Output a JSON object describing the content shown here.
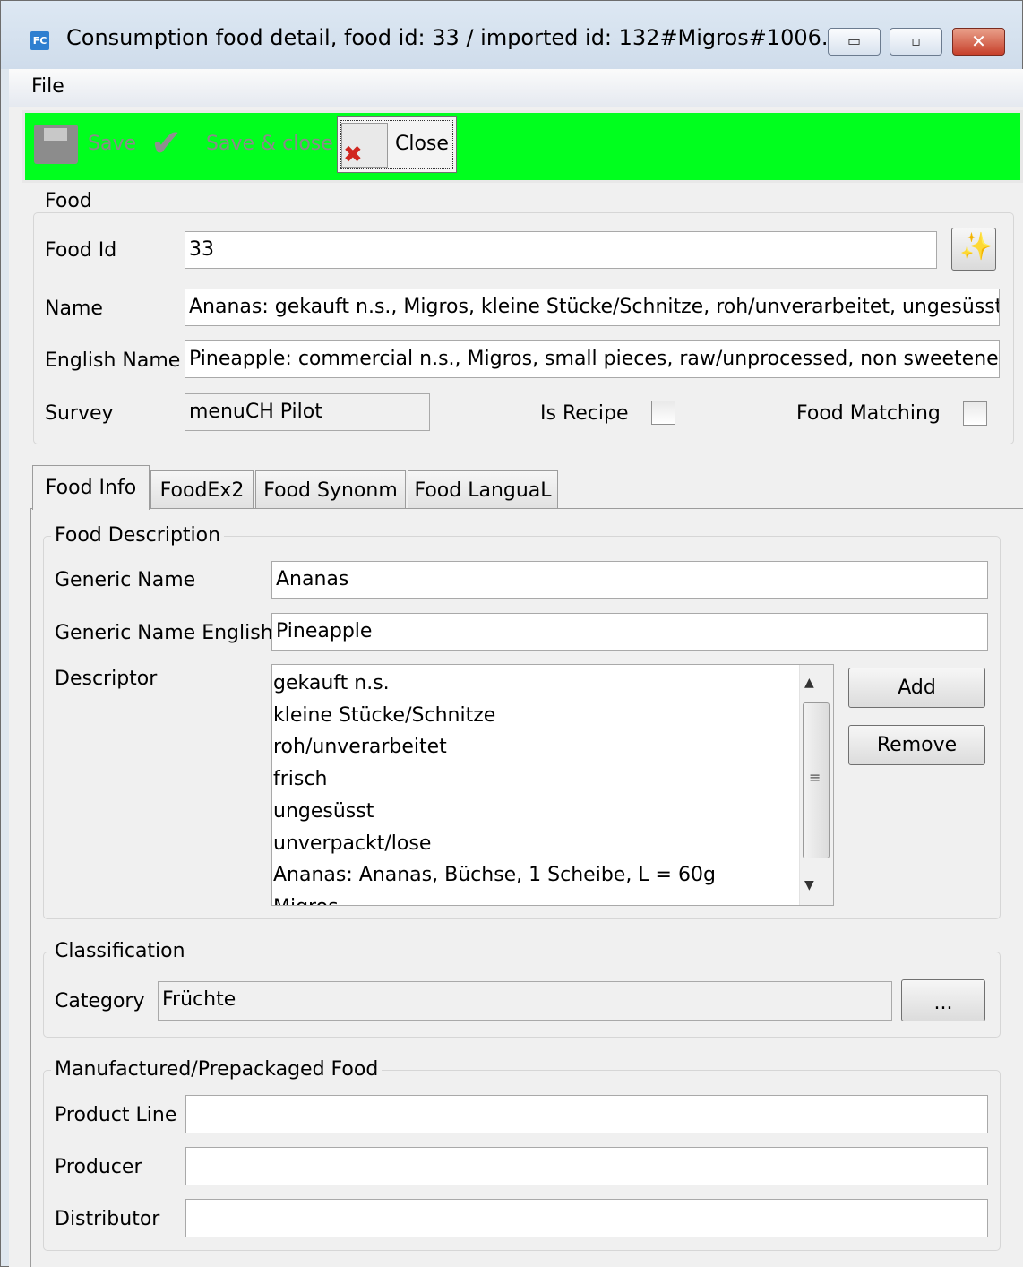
{
  "window": {
    "title": "Consumption food detail, food id: 33 / imported id: 132#Migros#1006...",
    "app_icon": "FC",
    "minimize": "▭",
    "maximize": "▫",
    "close": "✕"
  },
  "menu": {
    "file": "File"
  },
  "toolbar": {
    "save_label": "Save",
    "save_close_label": "Save & close",
    "close_label": "Close",
    "background": "#00ff1e"
  },
  "food": {
    "group_title": "Food",
    "food_id_label": "Food Id",
    "food_id": "33",
    "name_label": "Name",
    "name": "Ananas: gekauft n.s., Migros, kleine Stücke/Schnitze, roh/unverarbeitet, ungesüsst",
    "english_name_label": "English Name",
    "english_name": "Pineapple: commercial n.s., Migros, small pieces, raw/unprocessed, non sweetened",
    "survey_label": "Survey",
    "survey": "menuCH Pilot",
    "is_recipe_label": "Is Recipe",
    "is_recipe": false,
    "food_matching_label": "Food Matching",
    "food_matching": false
  },
  "tabs": [
    {
      "label": "Food Info",
      "active": true
    },
    {
      "label": "FoodEx2",
      "active": false
    },
    {
      "label": "Food Synonm",
      "active": false
    },
    {
      "label": "Food LanguaL",
      "active": false
    }
  ],
  "food_description": {
    "group_title": "Food Description",
    "generic_name_label": "Generic Name",
    "generic_name": "Ananas",
    "generic_name_english_label": "Generic Name English",
    "generic_name_english": "Pineapple",
    "descriptor_label": "Descriptor",
    "descriptors": [
      "gekauft n.s.",
      "kleine Stücke/Schnitze",
      "roh/unverarbeitet",
      "frisch",
      "ungesüsst",
      "unverpackt/lose",
      "Ananas: Ananas, Büchse, 1 Scheibe, L = 60g",
      "Migros"
    ],
    "add_label": "Add",
    "remove_label": "Remove"
  },
  "classification": {
    "group_title": "Classification",
    "category_label": "Category",
    "category": "Früchte",
    "browse_label": "..."
  },
  "manufactured": {
    "group_title": "Manufactured/Prepackaged Food",
    "product_line_label": "Product Line",
    "product_line": "",
    "producer_label": "Producer",
    "producer": "",
    "distributor_label": "Distributor",
    "distributor": ""
  }
}
